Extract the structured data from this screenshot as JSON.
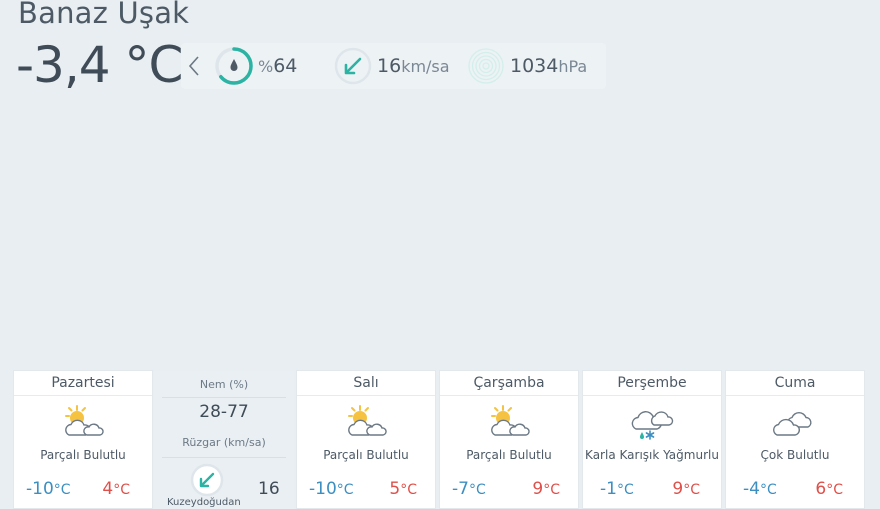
{
  "location": "Banaz Uşak",
  "current": {
    "temperature": "-3,4 °C",
    "humidity": {
      "prefix": "%",
      "value": "64",
      "percent": 64
    },
    "wind": {
      "value": "16",
      "unit": "km/sa"
    },
    "pressure": {
      "value": "1034",
      "unit": "hPa"
    }
  },
  "forecast": [
    {
      "name": "Pazartesi",
      "icon": "partly-cloudy-icon",
      "desc": "Parçalı Bulutlu",
      "min": "-10",
      "max": "4"
    },
    {
      "name": "Salı",
      "icon": "partly-cloudy-icon",
      "desc": "Parçalı Bulutlu",
      "min": "-10",
      "max": "5"
    },
    {
      "name": "Çarşamba",
      "icon": "partly-cloudy-icon",
      "desc": "Parçalı Bulutlu",
      "min": "-7",
      "max": "9"
    },
    {
      "name": "Perşembe",
      "icon": "sleet-icon",
      "desc": "Karla Karışık Yağmurlu",
      "min": "-1",
      "max": "9"
    },
    {
      "name": "Cuma",
      "icon": "cloudy-icon",
      "desc": "Çok Bulutlu",
      "min": "-4",
      "max": "6"
    }
  ],
  "detail": {
    "humidity_label": "Nem (%)",
    "humidity_range": "28-77",
    "wind_label": "Rüzgar (km/sa)",
    "wind_direction": "Kuzeydoğudan",
    "wind_speed": "16"
  },
  "units": {
    "celsius": "°C"
  },
  "colors": {
    "accent": "#2bb3a3",
    "min_temp": "#3d8fc2",
    "max_temp": "#e0504a"
  }
}
